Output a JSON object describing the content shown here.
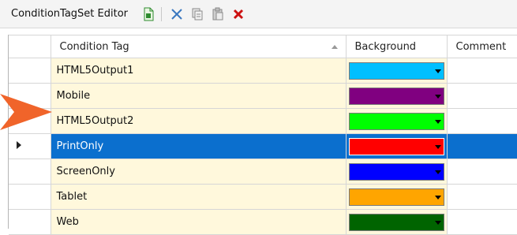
{
  "editor": {
    "title": "ConditionTagSet Editor"
  },
  "toolbar": {
    "buttons": [
      {
        "name": "new-tag-icon",
        "color": "#2e8b2e"
      },
      {
        "name": "cut-icon",
        "color": "#3a78c0"
      },
      {
        "name": "copy-icon",
        "color": "#8a8a8a"
      },
      {
        "name": "paste-icon",
        "color": "#8a8a8a"
      },
      {
        "name": "delete-icon",
        "color": "#cc1111"
      }
    ]
  },
  "grid": {
    "columns": {
      "tag": "Condition Tag",
      "background": "Background",
      "comment": "Comment"
    },
    "sort": {
      "column": "tag",
      "direction": "ascending"
    },
    "rows": [
      {
        "tag": "HTML5Output1",
        "color": "#00bfff",
        "comment": "",
        "selected": false
      },
      {
        "tag": "Mobile",
        "color": "#800080",
        "comment": "",
        "selected": false
      },
      {
        "tag": "HTML5Output2",
        "color": "#00ff00",
        "comment": "",
        "selected": false
      },
      {
        "tag": "PrintOnly",
        "color": "#ff0000",
        "comment": "",
        "selected": true
      },
      {
        "tag": "ScreenOnly",
        "color": "#0000ff",
        "comment": "",
        "selected": false
      },
      {
        "tag": "Tablet",
        "color": "#ffa500",
        "comment": "",
        "selected": false
      },
      {
        "tag": "Web",
        "color": "#006400",
        "comment": "",
        "selected": false
      }
    ]
  },
  "annotation": {
    "pointer_color": "#f0642a",
    "points_to_row": "HTML5Output2"
  },
  "colors": {
    "tag_cell_bg": "#fff8dc",
    "selection": "#0b6fce"
  }
}
